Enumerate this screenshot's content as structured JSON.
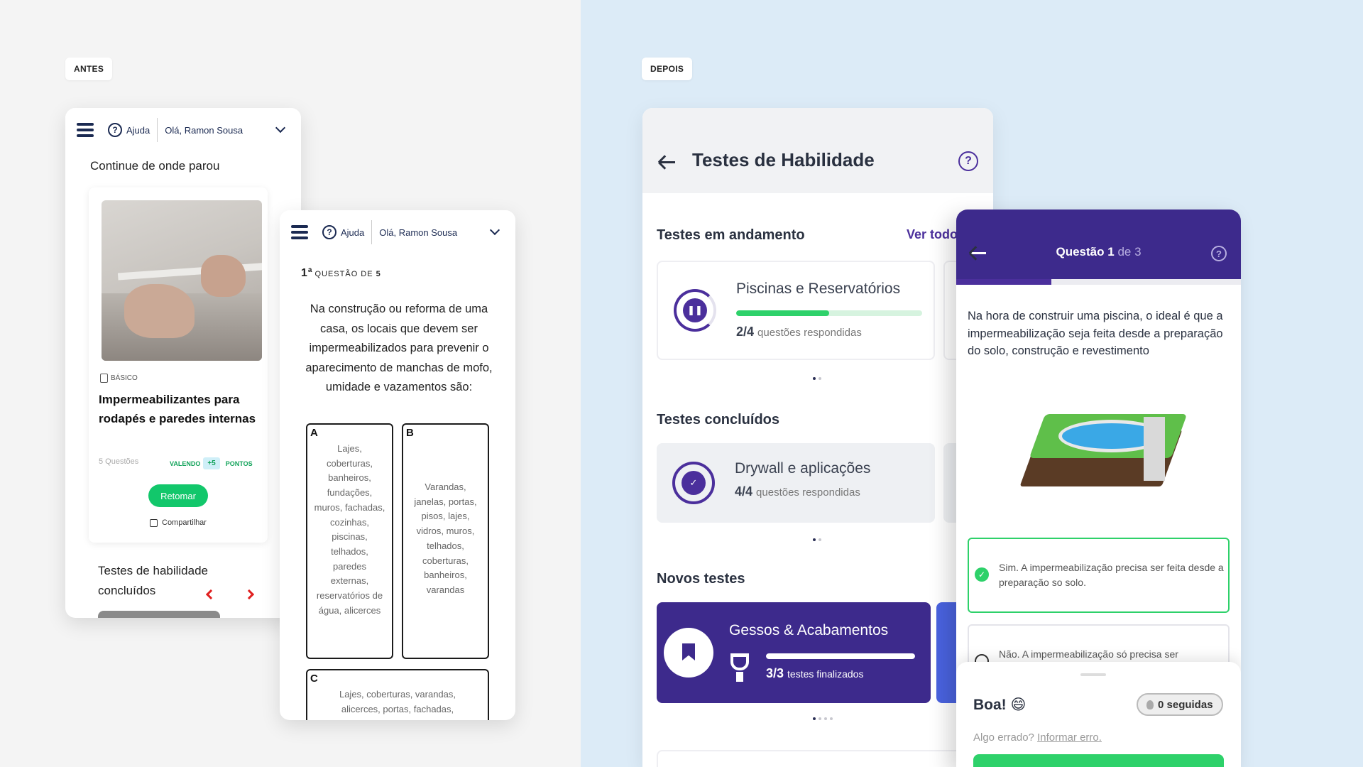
{
  "tags": {
    "before": "ANTES",
    "after": "DEPOIS"
  },
  "old_header": {
    "help": "Ajuda",
    "greeting": "Olá, Ramon Sousa"
  },
  "old_home": {
    "continue_title": "Continue de onde parou",
    "level": "BÁSICO",
    "course_title": "Impermeabilizantes para rodapés e paredes internas",
    "questions": "5 Questões",
    "worth_label": "VALENDO",
    "points_value": "+5",
    "points_label": "PONTOS",
    "resume_button": "Retomar",
    "share": "Compartilhar",
    "completed_title": "Testes de habilidade concluídos"
  },
  "old_question": {
    "number": "1",
    "number_suffix": "a",
    "counter": "QUESTÃO DE",
    "total": "5",
    "text": "Na construção ou reforma de uma casa, os locais que devem ser impermeabilizados para prevenir o aparecimento de manchas de mofo, umidade e vazamentos são:",
    "options": [
      {
        "letter": "A",
        "text": "Lajes, coberturas, banheiros, fundações, muros, fachadas, cozinhas, piscinas, telhados, paredes externas, reservatórios de água, alicerces"
      },
      {
        "letter": "B",
        "text": "Varandas, janelas, portas, pisos, lajes, vidros, muros, telhados, coberturas, banheiros, varandas"
      },
      {
        "letter": "C",
        "text": "Lajes, coberturas, varandas, alicerces, portas, fachadas,"
      }
    ]
  },
  "new_main": {
    "title": "Testes de Habilidade",
    "in_progress_title": "Testes em andamento",
    "see_all": "Ver todos",
    "in_progress_card": {
      "name": "Piscinas e Reservatórios",
      "answered": "2/4",
      "answered_label": "questões respondidas",
      "progress": 0.5
    },
    "completed_title": "Testes concluídos",
    "completed_card": {
      "name": "Drywall e aplicações",
      "answered": "4/4",
      "answered_label": "questões respondidas"
    },
    "new_title": "Novos testes",
    "new_card": {
      "name": "Gessos & Acabamentos",
      "done": "3/3",
      "done_label": "testes finalizados",
      "progress": 1.0
    }
  },
  "quiz": {
    "question_label": "Questão",
    "current": "1",
    "of_label": "de 3",
    "progress": 0.333,
    "text": "Na hora de construir uma piscina, o ideal é que a impermeabilização seja feita desde a preparação do solo, construção e revestimento",
    "answer_correct": "Sim. A impermeabilização precisa ser feita desde a preparação so solo.",
    "answer_other": "Não. A impermeabilização só precisa ser",
    "feedback_title": "Boa!",
    "feedback_emoji": "😄",
    "streak": "0 seguidas",
    "error_text": "Algo errado?",
    "report_link": "Informar erro."
  },
  "colors": {
    "brand_purple": "#3d2a8c",
    "success_green": "#2ed16a",
    "old_green": "#12c76b",
    "old_red": "#e02020"
  }
}
